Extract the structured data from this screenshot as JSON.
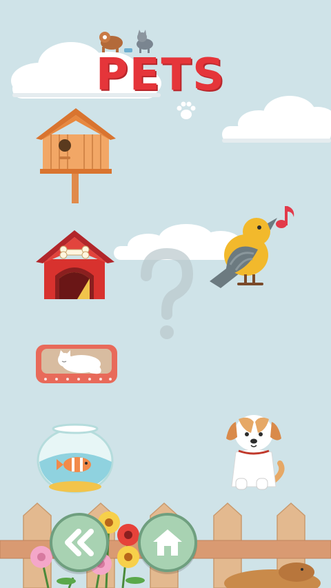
{
  "title": "PETS",
  "colors": {
    "sky": "#cfe3e8",
    "title_red": "#e5353a",
    "button_green": "#a8d2b2",
    "fence": "#e3b98f"
  },
  "icons": {
    "back": "double-chevron-left-icon",
    "home": "home-icon"
  }
}
